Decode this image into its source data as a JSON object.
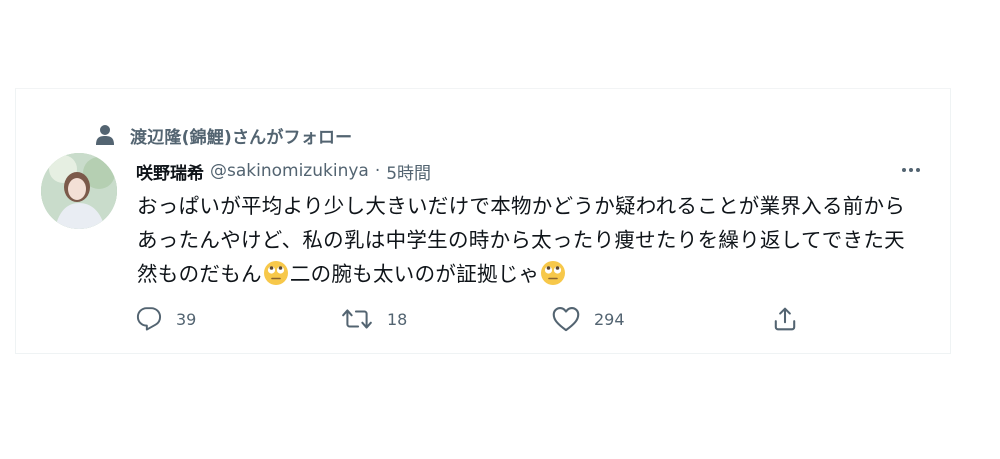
{
  "social_context": {
    "text": "渡辺隆(錦鯉)さんがフォロー"
  },
  "tweet": {
    "display_name": "咲野瑞希",
    "handle": "@sakinomizukinya",
    "separator": "·",
    "time": "5時間",
    "text_part1": "おっぱいが平均より少し大きいだけで本物かどうか疑われることが業界入る前からあったんやけど、私の乳は中学生の時から太ったり痩せたりを繰り返してできた天然ものだもん",
    "text_part2": "二の腕も太いのが証拠じゃ",
    "emoji": "face-with-rolling-eyes"
  },
  "actions": {
    "reply_count": "39",
    "retweet_count": "18",
    "like_count": "294"
  },
  "icons": [
    "person-icon",
    "more-icon",
    "reply-icon",
    "retweet-icon",
    "like-icon",
    "share-icon"
  ]
}
